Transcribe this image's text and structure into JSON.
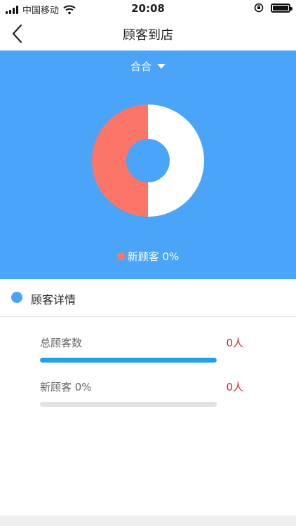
{
  "status_bar": {
    "carrier": "中国移动",
    "time": "20:08",
    "icons": [
      "signal-icon",
      "wifi-icon",
      "orientation-lock-icon",
      "battery-icon"
    ]
  },
  "nav": {
    "title": "顾客到店",
    "back_icon": "back-chevron-icon"
  },
  "colors": {
    "panel_blue": "#4aa4f7",
    "new_customer_salmon": "#fb7668",
    "donut_white": "#ffffff",
    "total_bar_blue": "#21a1e8",
    "value_red": "#e52323"
  },
  "filter": {
    "selected": "合合",
    "icon": "dropdown-caret-icon"
  },
  "chart_data": {
    "type": "pie",
    "variant": "donut",
    "slices": [
      {
        "name": "新顾客",
        "value": 50,
        "color": "#fb7668"
      },
      {
        "name": "",
        "value": 50,
        "color": "#ffffff"
      }
    ],
    "legend": [
      {
        "label": "新顾客 0%",
        "color": "#fb7668"
      }
    ],
    "legend_position": "bottom-center"
  },
  "section": {
    "title": "顾客详情",
    "dot_color": "#4aa4f7"
  },
  "details": [
    {
      "label": "总顾客数",
      "value": "0人",
      "bar_fraction": 1.0,
      "bar_color": "#21a1e8"
    },
    {
      "label": "新顾客 0%",
      "value": "0人",
      "bar_fraction": 0.0,
      "bar_color": "#fb7668"
    }
  ]
}
